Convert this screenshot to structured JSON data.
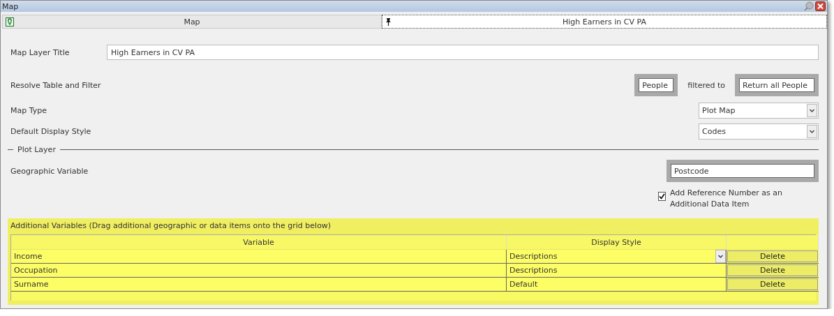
{
  "window": {
    "title": "Map"
  },
  "tabs": [
    {
      "label": "Map",
      "selected": false
    },
    {
      "label": "High Earners in CV PA",
      "selected": true
    }
  ],
  "form": {
    "map_layer_title": {
      "label": "Map Layer Title",
      "value": "High Earners in CV PA"
    },
    "resolve": {
      "label": "Resolve Table and Filter",
      "table": "People",
      "connector": "filtered to",
      "filter": "Return all People"
    },
    "map_type": {
      "label": "Map Type",
      "value": "Plot Map"
    },
    "display_style": {
      "label": "Default Display Style",
      "value": "Codes"
    }
  },
  "plot_layer": {
    "title": "Plot Layer",
    "geographic_variable": {
      "label": "Geographic Variable",
      "value": "Postcode"
    },
    "add_reference": {
      "label": "Add Reference Number as an Additional Data Item",
      "checked": true
    }
  },
  "additional": {
    "title": "Additional Variables (Drag additional geographic or data items onto the grid below)",
    "columns": [
      "Variable",
      "Display Style"
    ],
    "rows": [
      {
        "variable": "Income",
        "display_style": "Descriptions",
        "dropdown": true,
        "action": "Delete"
      },
      {
        "variable": "Occupation",
        "display_style": "Descriptions",
        "dropdown": false,
        "action": "Delete"
      },
      {
        "variable": "Surname",
        "display_style": "Default",
        "dropdown": false,
        "action": "Delete"
      }
    ]
  }
}
